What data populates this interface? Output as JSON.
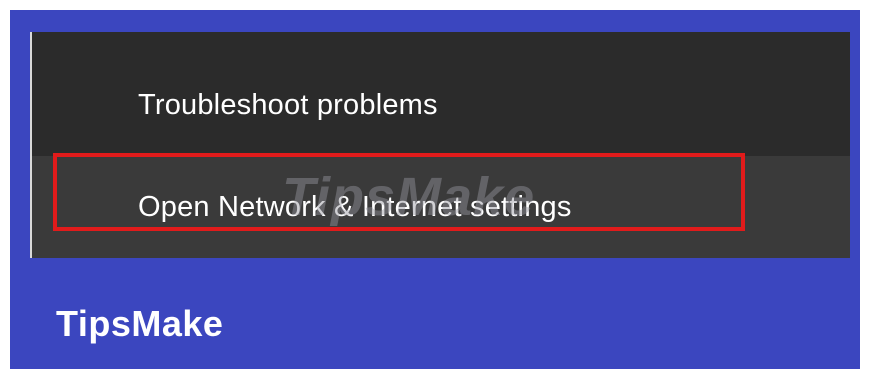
{
  "context_menu": {
    "items": [
      {
        "label": "Troubleshoot problems"
      },
      {
        "label": "Open Network & Internet settings"
      }
    ]
  },
  "branding": {
    "watermark": "TipsMake",
    "logo_text": "TipsMake"
  },
  "colors": {
    "background_blue": "#3b46bf",
    "menu_background": "#2b2b2b",
    "highlight_red": "#e11b1b",
    "text": "#ffffff"
  }
}
